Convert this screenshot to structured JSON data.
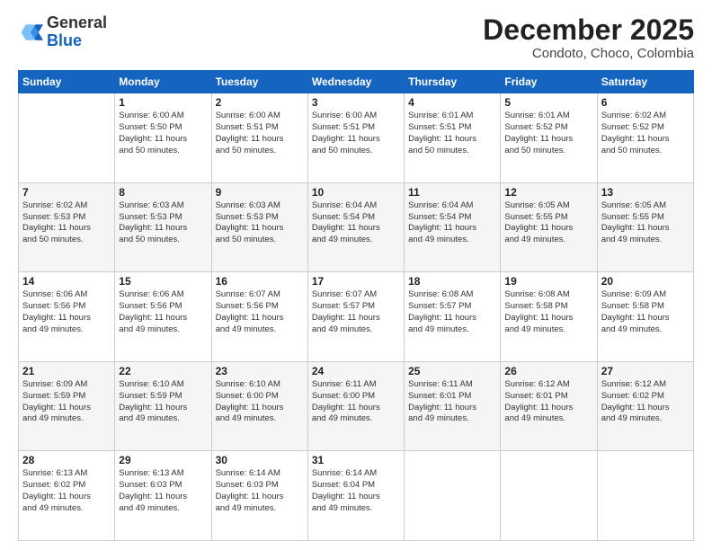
{
  "header": {
    "logo_general": "General",
    "logo_blue": "Blue",
    "month_title": "December 2025",
    "subtitle": "Condoto, Choco, Colombia"
  },
  "days_of_week": [
    "Sunday",
    "Monday",
    "Tuesday",
    "Wednesday",
    "Thursday",
    "Friday",
    "Saturday"
  ],
  "weeks": [
    [
      {
        "day": "",
        "info": ""
      },
      {
        "day": "1",
        "info": "Sunrise: 6:00 AM\nSunset: 5:50 PM\nDaylight: 11 hours\nand 50 minutes."
      },
      {
        "day": "2",
        "info": "Sunrise: 6:00 AM\nSunset: 5:51 PM\nDaylight: 11 hours\nand 50 minutes."
      },
      {
        "day": "3",
        "info": "Sunrise: 6:00 AM\nSunset: 5:51 PM\nDaylight: 11 hours\nand 50 minutes."
      },
      {
        "day": "4",
        "info": "Sunrise: 6:01 AM\nSunset: 5:51 PM\nDaylight: 11 hours\nand 50 minutes."
      },
      {
        "day": "5",
        "info": "Sunrise: 6:01 AM\nSunset: 5:52 PM\nDaylight: 11 hours\nand 50 minutes."
      },
      {
        "day": "6",
        "info": "Sunrise: 6:02 AM\nSunset: 5:52 PM\nDaylight: 11 hours\nand 50 minutes."
      }
    ],
    [
      {
        "day": "7",
        "info": "Sunrise: 6:02 AM\nSunset: 5:53 PM\nDaylight: 11 hours\nand 50 minutes."
      },
      {
        "day": "8",
        "info": "Sunrise: 6:03 AM\nSunset: 5:53 PM\nDaylight: 11 hours\nand 50 minutes."
      },
      {
        "day": "9",
        "info": "Sunrise: 6:03 AM\nSunset: 5:53 PM\nDaylight: 11 hours\nand 50 minutes."
      },
      {
        "day": "10",
        "info": "Sunrise: 6:04 AM\nSunset: 5:54 PM\nDaylight: 11 hours\nand 49 minutes."
      },
      {
        "day": "11",
        "info": "Sunrise: 6:04 AM\nSunset: 5:54 PM\nDaylight: 11 hours\nand 49 minutes."
      },
      {
        "day": "12",
        "info": "Sunrise: 6:05 AM\nSunset: 5:55 PM\nDaylight: 11 hours\nand 49 minutes."
      },
      {
        "day": "13",
        "info": "Sunrise: 6:05 AM\nSunset: 5:55 PM\nDaylight: 11 hours\nand 49 minutes."
      }
    ],
    [
      {
        "day": "14",
        "info": "Sunrise: 6:06 AM\nSunset: 5:56 PM\nDaylight: 11 hours\nand 49 minutes."
      },
      {
        "day": "15",
        "info": "Sunrise: 6:06 AM\nSunset: 5:56 PM\nDaylight: 11 hours\nand 49 minutes."
      },
      {
        "day": "16",
        "info": "Sunrise: 6:07 AM\nSunset: 5:56 PM\nDaylight: 11 hours\nand 49 minutes."
      },
      {
        "day": "17",
        "info": "Sunrise: 6:07 AM\nSunset: 5:57 PM\nDaylight: 11 hours\nand 49 minutes."
      },
      {
        "day": "18",
        "info": "Sunrise: 6:08 AM\nSunset: 5:57 PM\nDaylight: 11 hours\nand 49 minutes."
      },
      {
        "day": "19",
        "info": "Sunrise: 6:08 AM\nSunset: 5:58 PM\nDaylight: 11 hours\nand 49 minutes."
      },
      {
        "day": "20",
        "info": "Sunrise: 6:09 AM\nSunset: 5:58 PM\nDaylight: 11 hours\nand 49 minutes."
      }
    ],
    [
      {
        "day": "21",
        "info": "Sunrise: 6:09 AM\nSunset: 5:59 PM\nDaylight: 11 hours\nand 49 minutes."
      },
      {
        "day": "22",
        "info": "Sunrise: 6:10 AM\nSunset: 5:59 PM\nDaylight: 11 hours\nand 49 minutes."
      },
      {
        "day": "23",
        "info": "Sunrise: 6:10 AM\nSunset: 6:00 PM\nDaylight: 11 hours\nand 49 minutes."
      },
      {
        "day": "24",
        "info": "Sunrise: 6:11 AM\nSunset: 6:00 PM\nDaylight: 11 hours\nand 49 minutes."
      },
      {
        "day": "25",
        "info": "Sunrise: 6:11 AM\nSunset: 6:01 PM\nDaylight: 11 hours\nand 49 minutes."
      },
      {
        "day": "26",
        "info": "Sunrise: 6:12 AM\nSunset: 6:01 PM\nDaylight: 11 hours\nand 49 minutes."
      },
      {
        "day": "27",
        "info": "Sunrise: 6:12 AM\nSunset: 6:02 PM\nDaylight: 11 hours\nand 49 minutes."
      }
    ],
    [
      {
        "day": "28",
        "info": "Sunrise: 6:13 AM\nSunset: 6:02 PM\nDaylight: 11 hours\nand 49 minutes."
      },
      {
        "day": "29",
        "info": "Sunrise: 6:13 AM\nSunset: 6:03 PM\nDaylight: 11 hours\nand 49 minutes."
      },
      {
        "day": "30",
        "info": "Sunrise: 6:14 AM\nSunset: 6:03 PM\nDaylight: 11 hours\nand 49 minutes."
      },
      {
        "day": "31",
        "info": "Sunrise: 6:14 AM\nSunset: 6:04 PM\nDaylight: 11 hours\nand 49 minutes."
      },
      {
        "day": "",
        "info": ""
      },
      {
        "day": "",
        "info": ""
      },
      {
        "day": "",
        "info": ""
      }
    ]
  ]
}
